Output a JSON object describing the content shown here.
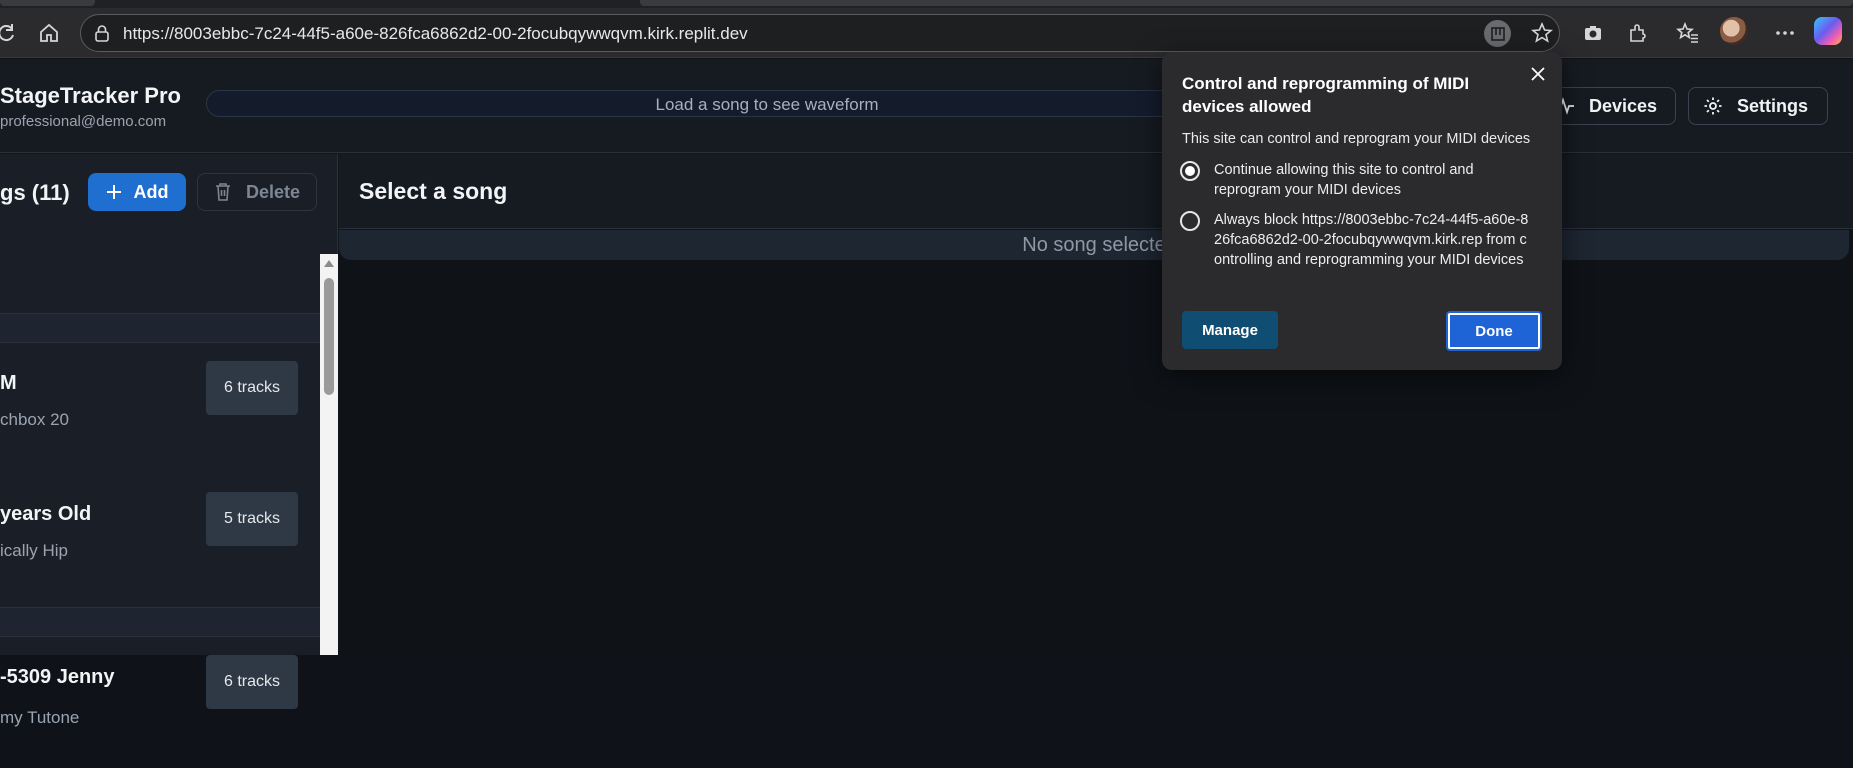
{
  "browser": {
    "url": "https://8003ebbc-7c24-44f5-a60e-826fca6862d2-00-2focubqywwqvm.kirk.replit.dev"
  },
  "app": {
    "title": "StageTracker Pro",
    "user_email": "professional@demo.com",
    "waveform_placeholder": "Load a song to see waveform",
    "devices_label": "Devices",
    "settings_label": "Settings"
  },
  "songs_panel": {
    "title": "gs (11)",
    "add_label": "Add",
    "delete_label": "Delete",
    "items": [
      {
        "title": "M",
        "artist": "chbox 20",
        "tracks": "6 tracks"
      },
      {
        "title": "years Old",
        "artist": "ically Hip",
        "tracks": "5 tracks"
      },
      {
        "title": "-5309 Jenny",
        "artist": "my Tutone",
        "tracks": "6 tracks"
      }
    ]
  },
  "main": {
    "title": "Select a song",
    "no_song_text": "No song selecte"
  },
  "midi_popup": {
    "title": "Control and reprogramming of MIDI devices allowed",
    "description": "This site can control and reprogram your MIDI devices",
    "option_allow": "Continue allowing this site to control and reprogram your MIDI devices",
    "option_block": "Always block https://8003ebbc-7c24-44f5-a60e-826fca6862d2-00-2focubqywwqvm.kirk.rep from controlling and reprogramming your MIDI devices",
    "selected_option": "allow",
    "manage_label": "Manage",
    "done_label": "Done"
  },
  "colors": {
    "accent": "#1f6fd1",
    "done": "#1f64d6",
    "manage": "#0f4d72"
  }
}
